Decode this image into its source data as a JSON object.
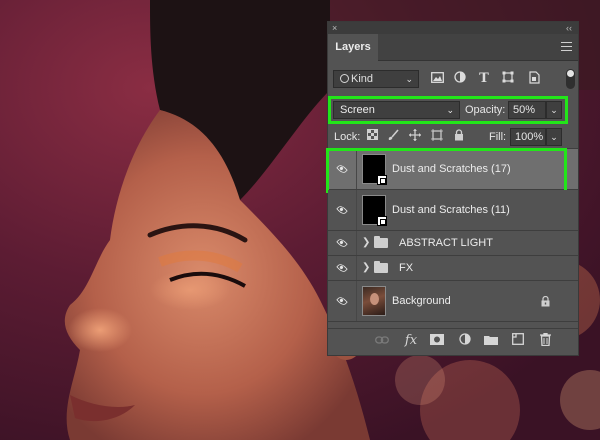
{
  "panel": {
    "title": "Layers",
    "close_glyph": "×",
    "collapse_glyph": "‹‹"
  },
  "filter": {
    "kind_label": "Kind",
    "icons": [
      "image-filter-icon",
      "adjustment-filter-icon",
      "type-filter-icon",
      "shape-filter-icon",
      "smart-object-filter-icon"
    ],
    "type_glyph": "T"
  },
  "blend": {
    "mode": "Screen",
    "opacity_label": "Opacity:",
    "opacity_value": "50%"
  },
  "lock": {
    "label": "Lock:",
    "fill_label": "Fill:",
    "fill_value": "100%"
  },
  "layers": [
    {
      "name": "Dust and Scratches (17)",
      "type": "smart-object",
      "selected": true,
      "visible": true
    },
    {
      "name": "Dust and Scratches (11)",
      "type": "smart-object",
      "selected": false,
      "visible": true
    },
    {
      "name": "ABSTRACT LIGHT",
      "type": "group",
      "selected": false,
      "visible": true
    },
    {
      "name": "FX",
      "type": "group",
      "selected": false,
      "visible": true
    },
    {
      "name": "Background",
      "type": "image",
      "selected": false,
      "visible": true,
      "locked": true
    }
  ],
  "bottom_icons": [
    "link-layers-icon",
    "fx-icon",
    "add-mask-icon",
    "adjustment-layer-icon",
    "new-group-icon",
    "new-layer-icon",
    "delete-layer-icon"
  ],
  "bottom_fx_label": "fx",
  "colors": {
    "highlight": "#22e619",
    "panel_bg": "#535353",
    "selected_row": "#6f6f6f"
  }
}
